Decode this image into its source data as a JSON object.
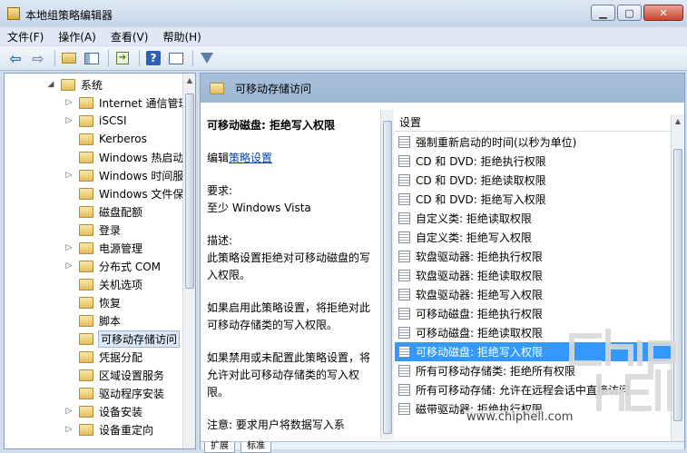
{
  "window": {
    "title": "本地组策略编辑器"
  },
  "menu": [
    "文件(F)",
    "操作(A)",
    "查看(V)",
    "帮助(H)"
  ],
  "toolbar": {
    "icons": [
      "back-arrow-icon",
      "forward-arrow-icon",
      "up-folder-icon",
      "show-pane-icon",
      "export-list-icon",
      "help-icon",
      "properties-icon",
      "filter-icon"
    ]
  },
  "tree": [
    {
      "label": "系统",
      "expander": "◢",
      "selected": false
    },
    {
      "label": "Internet 通信管理",
      "expander": "▷",
      "selected": false
    },
    {
      "label": "iSCSI",
      "expander": "▷",
      "selected": false
    },
    {
      "label": "Kerberos",
      "expander": "",
      "selected": false
    },
    {
      "label": "Windows 热启动",
      "expander": "",
      "selected": false
    },
    {
      "label": "Windows 时间服务",
      "expander": "▷",
      "selected": false
    },
    {
      "label": "Windows 文件保护",
      "expander": "",
      "selected": false
    },
    {
      "label": "磁盘配额",
      "expander": "",
      "selected": false
    },
    {
      "label": "登录",
      "expander": "",
      "selected": false
    },
    {
      "label": "电源管理",
      "expander": "▷",
      "selected": false
    },
    {
      "label": "分布式 COM",
      "expander": "▷",
      "selected": false
    },
    {
      "label": "关机选项",
      "expander": "",
      "selected": false
    },
    {
      "label": "恢复",
      "expander": "",
      "selected": false
    },
    {
      "label": "脚本",
      "expander": "",
      "selected": false
    },
    {
      "label": "可移动存储访问",
      "expander": "",
      "selected": true
    },
    {
      "label": "凭据分配",
      "expander": "",
      "selected": false
    },
    {
      "label": "区域设置服务",
      "expander": "",
      "selected": false
    },
    {
      "label": "驱动程序安装",
      "expander": "",
      "selected": false
    },
    {
      "label": "设备安装",
      "expander": "▷",
      "selected": false
    },
    {
      "label": "设备重定向",
      "expander": "▷",
      "selected": false
    }
  ],
  "right": {
    "header_title": "可移动存储访问",
    "description": {
      "title": "可移动磁盘: 拒绝写入权限",
      "edit_prefix": "编辑",
      "edit_link": "策略设置",
      "requirements_label": "要求:",
      "requirements_value": "至少 Windows Vista",
      "desc_label": "描述:",
      "desc_text": "此策略设置拒绝对可移动磁盘的写入权限。",
      "para1": "如果启用此策略设置，将拒绝对此可移动存储类的写入权限。",
      "para2": "如果禁用或未配置此策略设置，将允许对此可移动存储类的写入权限。",
      "para3": "注意: 要求用户将数据写入系"
    },
    "list_header": "设置",
    "settings": [
      "强制重新启动的时间(以秒为单位)",
      "CD 和 DVD: 拒绝执行权限",
      "CD 和 DVD: 拒绝读取权限",
      "CD 和 DVD: 拒绝写入权限",
      "自定义类: 拒绝读取权限",
      "自定义类: 拒绝写入权限",
      "软盘驱动器: 拒绝执行权限",
      "软盘驱动器: 拒绝读取权限",
      "软盘驱动器: 拒绝写入权限",
      "可移动磁盘: 拒绝执行权限",
      "可移动磁盘: 拒绝读取权限",
      "可移动磁盘: 拒绝写入权限",
      "所有可移动存储类: 拒绝所有权限",
      "所有可移动存储: 允许在远程会话中直接访问",
      "磁带驱动器: 拒绝执行权限"
    ],
    "selected_setting_index": 11,
    "tabs": [
      "扩展",
      "标准"
    ]
  },
  "watermark": {
    "logo_text": "chiphell",
    "url": "www.chiphell.com"
  },
  "colors": {
    "selection": "#3399ff",
    "header_bg": "#a9c0da",
    "link": "#0645ad"
  }
}
